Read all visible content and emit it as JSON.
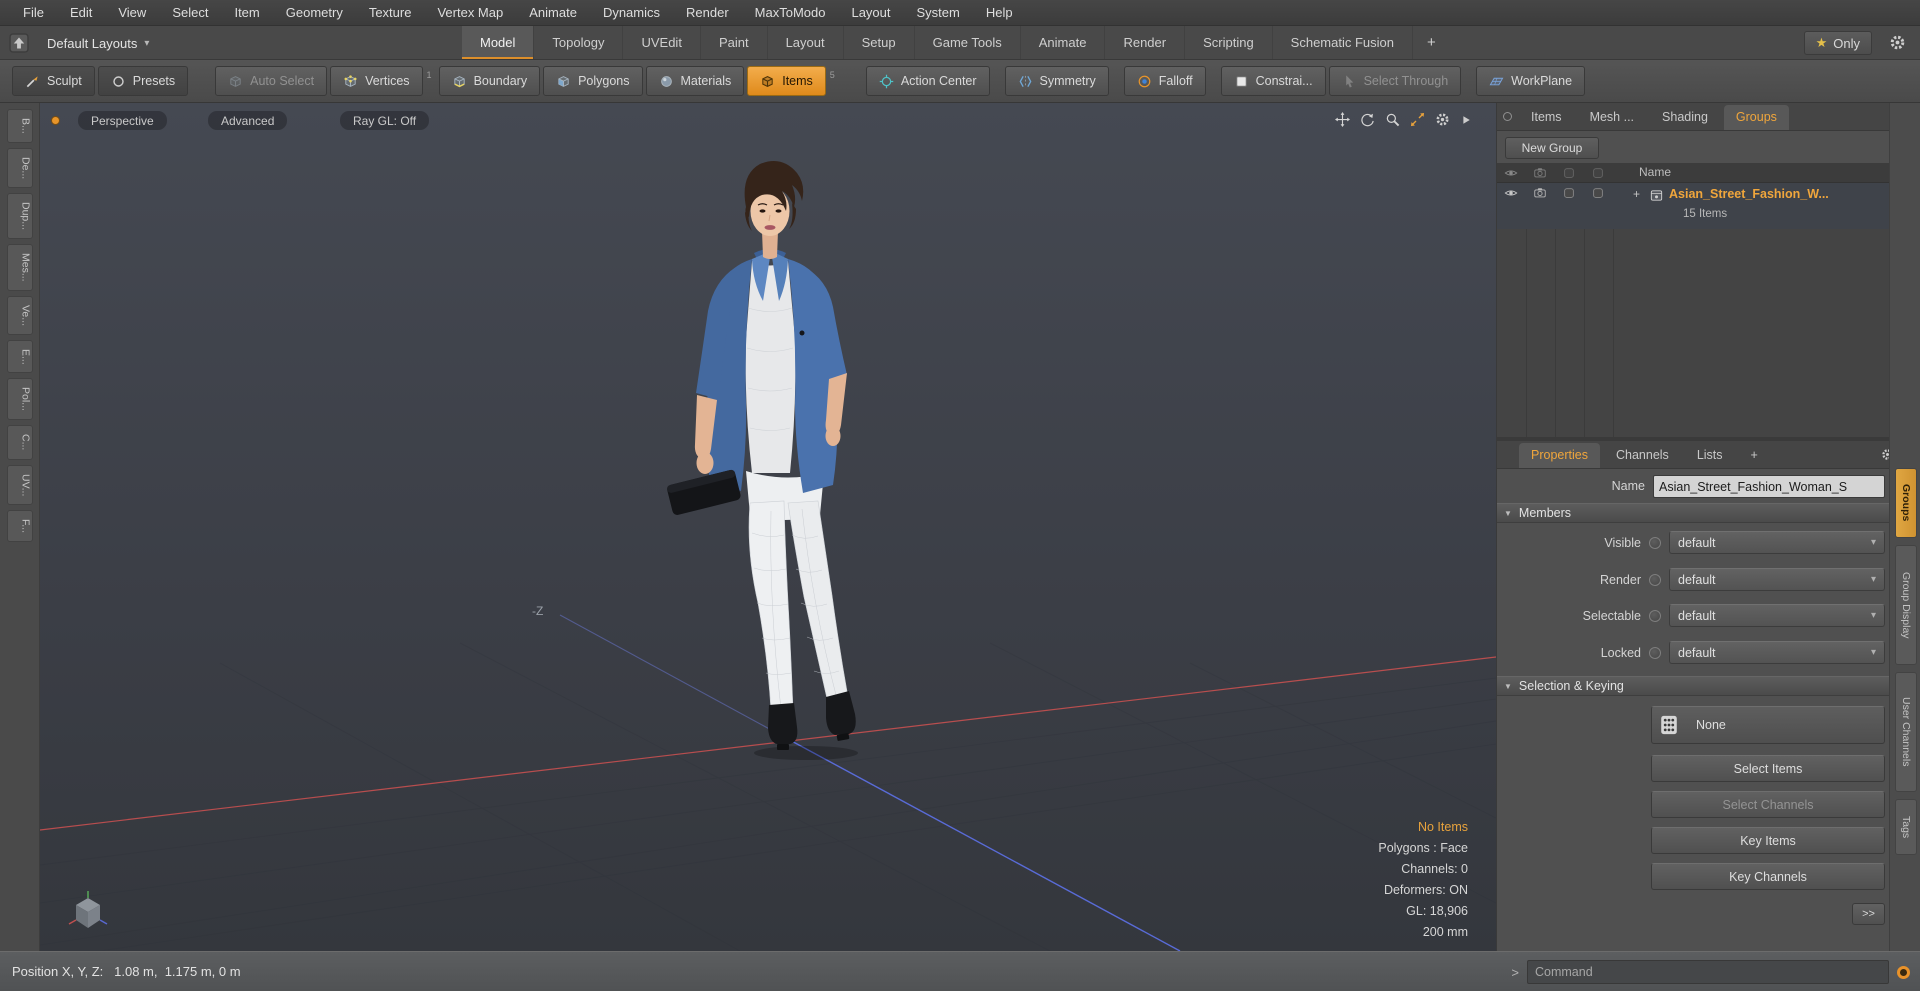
{
  "accent_color": "#e8952a",
  "icons": {
    "star": "★",
    "chevron_down": "▾",
    "section_triangle": "▼",
    "plus": "+",
    "prompt": ">"
  },
  "menu": {
    "items": [
      "File",
      "Edit",
      "View",
      "Select",
      "Item",
      "Geometry",
      "Texture",
      "Vertex Map",
      "Animate",
      "Dynamics",
      "Render",
      "MaxToModo",
      "Layout",
      "System",
      "Help"
    ]
  },
  "layout_bar": {
    "layouts_label": "Default Layouts",
    "tabs": [
      "Model",
      "Topology",
      "UVEdit",
      "Paint",
      "Layout",
      "Setup",
      "Game Tools",
      "Animate",
      "Render",
      "Scripting",
      "Schematic Fusion"
    ],
    "active_tab": "Model",
    "add_tab_label": "+",
    "only_label": "Only"
  },
  "toolbar": {
    "sculpt_label": "Sculpt",
    "presets_label": "Presets",
    "modes": [
      {
        "label": "Auto Select"
      },
      {
        "label": "Vertices",
        "badge": "1"
      },
      {
        "label": "Boundary"
      },
      {
        "label": "Polygons"
      },
      {
        "label": "Materials"
      },
      {
        "label": "Items",
        "badge": "5"
      }
    ],
    "tools": [
      {
        "label": "Action Center"
      },
      {
        "label": "Symmetry"
      },
      {
        "label": "Falloff"
      },
      {
        "label": "Constrai..."
      },
      {
        "label": "Select Through"
      },
      {
        "label": "WorkPlane"
      }
    ]
  },
  "left_strip": {
    "tabs": [
      "B...",
      "De...",
      "Dup...",
      "Mes...",
      "Ve...",
      "E...",
      "Pol...",
      "C...",
      "UV...",
      "F..."
    ]
  },
  "viewport": {
    "view_buttons": [
      "Perspective",
      "Advanced",
      "Ray GL: Off"
    ],
    "axis_label": "-Z",
    "stats": [
      "No Items",
      "Polygons : Face",
      "Channels: 0",
      "Deformers: ON",
      "GL: 18,906",
      "200 mm"
    ]
  },
  "groups_panel": {
    "tabs": [
      "Items",
      "Mesh ...",
      "Shading",
      "Groups"
    ],
    "active_tab": "Groups",
    "new_group_label": "New Group",
    "name_header": "Name",
    "row": {
      "name": "Asian_Street_Fashion_W...",
      "count": "15 Items"
    }
  },
  "properties_panel": {
    "tabs": [
      "Properties",
      "Channels",
      "Lists",
      "+"
    ],
    "active_tab": "Properties",
    "name_label": "Name",
    "name_value": "Asian_Street_Fashion_Woman_S",
    "members_header": "Members",
    "member_rows": [
      {
        "label": "Visible",
        "value": "default"
      },
      {
        "label": "Render",
        "value": "default"
      },
      {
        "label": "Selectable",
        "value": "default"
      },
      {
        "label": "Locked",
        "value": "default"
      }
    ],
    "selection_header": "Selection & Keying",
    "none_label": "None",
    "buttons": [
      "Select Items",
      "Select Channels",
      "Key Items",
      "Key Channels"
    ],
    "expand_label": ">>"
  },
  "side_tabs": [
    "Groups",
    "Group Display",
    "User Channels",
    "Tags"
  ],
  "status_bar": {
    "position_text": "Position X, Y, Z:   1.08 m,  1.175 m, 0 m",
    "command_placeholder": "Command"
  }
}
